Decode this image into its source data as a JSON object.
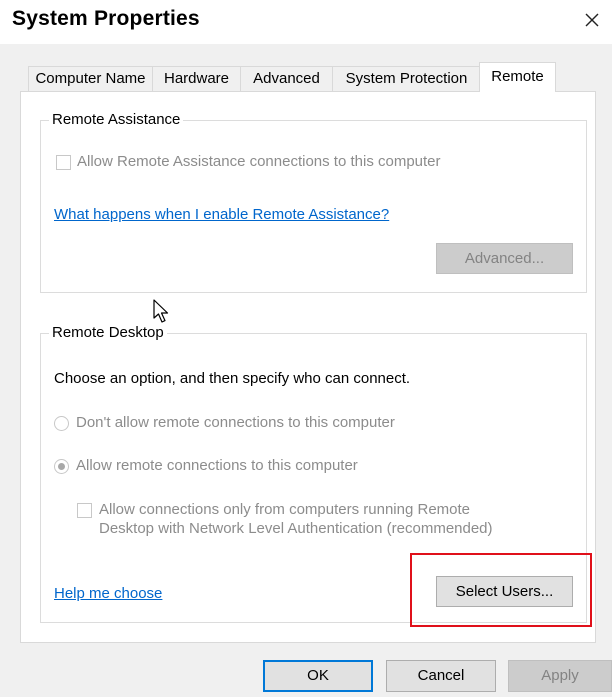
{
  "window": {
    "title": "System Properties",
    "close_icon": "close-icon"
  },
  "tabs": [
    {
      "label": "Computer Name",
      "active": false
    },
    {
      "label": "Hardware",
      "active": false
    },
    {
      "label": "Advanced",
      "active": false
    },
    {
      "label": "System Protection",
      "active": false
    },
    {
      "label": "Remote",
      "active": true
    }
  ],
  "remote_assistance": {
    "group_label": "Remote Assistance",
    "allow_checkbox_label": "Allow Remote Assistance connections to this computer",
    "allow_checked": false,
    "help_link": "What happens when I enable Remote Assistance?",
    "advanced_button": "Advanced..."
  },
  "remote_desktop": {
    "group_label": "Remote Desktop",
    "instruction": "Choose an option, and then specify who can connect.",
    "option_dont_allow": "Don't allow remote connections to this computer",
    "option_allow": "Allow remote connections to this computer",
    "selected_option": "allow",
    "nla_checkbox_line1": "Allow connections only from computers running Remote",
    "nla_checkbox_line2": "Desktop with Network Level Authentication (recommended)",
    "nla_checked": false,
    "help_link": "Help me choose",
    "select_users_button": "Select Users..."
  },
  "footer": {
    "ok_button": "OK",
    "cancel_button": "Cancel",
    "apply_button": "Apply"
  },
  "colors": {
    "link": "#0066cc",
    "highlight_box": "#e0101a",
    "default_button_border": "#0078d7"
  }
}
